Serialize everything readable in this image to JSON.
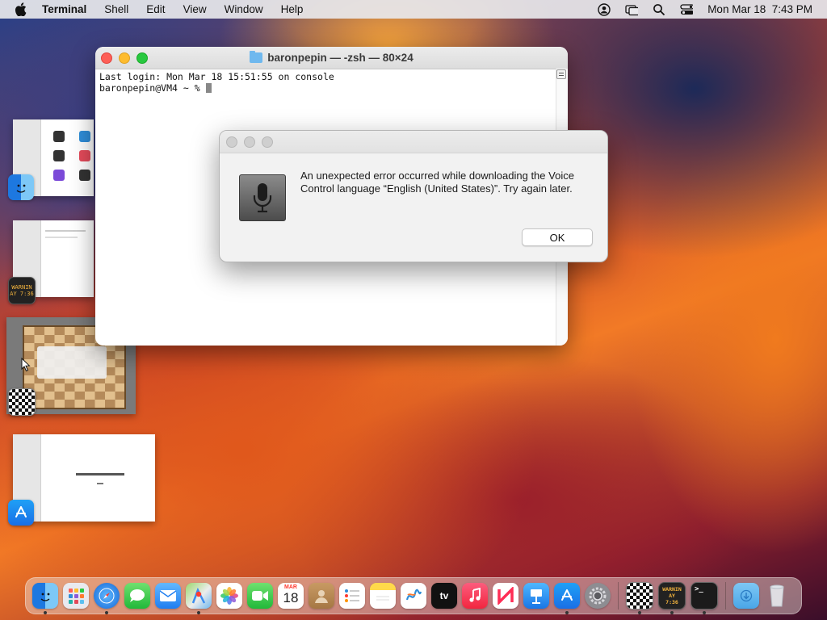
{
  "menubar": {
    "app_name": "Terminal",
    "items": [
      "Shell",
      "Edit",
      "View",
      "Window",
      "Help"
    ],
    "status_icons": [
      "user-icon",
      "screen-mirroring-icon",
      "search-icon",
      "control-center-icon"
    ],
    "datetime": "Mon Mar 18  7:43 PM"
  },
  "terminal": {
    "title": "baronpepin — -zsh — 80×24",
    "line1": "Last login: Mon Mar 18 15:51:55 on console",
    "prompt": "baronpepin@VM4 ~ % "
  },
  "alert": {
    "message": "An unexpected error occurred while downloading the Voice Control language “English (United States)”. Try again later.",
    "ok_label": "OK"
  },
  "stage_manager": {
    "groups": [
      "finder",
      "console",
      "chess",
      "app-store"
    ],
    "console_badge": "WARNIN\nAY 7:36"
  },
  "dock": {
    "calendar_month": "MAR",
    "calendar_day": "18",
    "tv_label": "tv",
    "console_label": "WARNIN AY 7:36",
    "terminal_label": ">_"
  },
  "colors": {
    "accent_red": "#fe5f57",
    "accent_yellow": "#febc2e",
    "accent_green": "#28c840"
  }
}
